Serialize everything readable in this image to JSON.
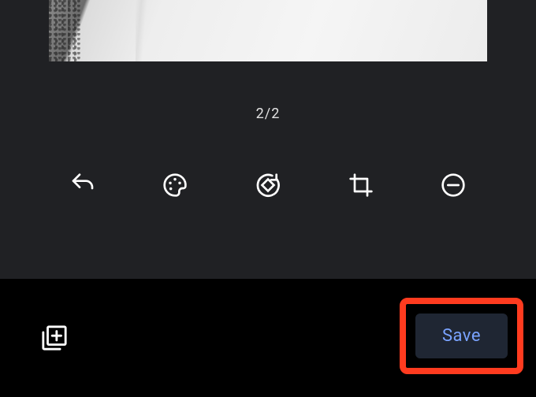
{
  "preview": {
    "pageIndicator": "2/2"
  },
  "toolbar": {
    "undo": "undo-icon",
    "palette": "palette-icon",
    "rotate": "rotate-icon",
    "crop": "crop-icon",
    "remove": "remove-icon"
  },
  "bottomBar": {
    "addPage": "add-page-icon",
    "saveLabel": "Save"
  }
}
